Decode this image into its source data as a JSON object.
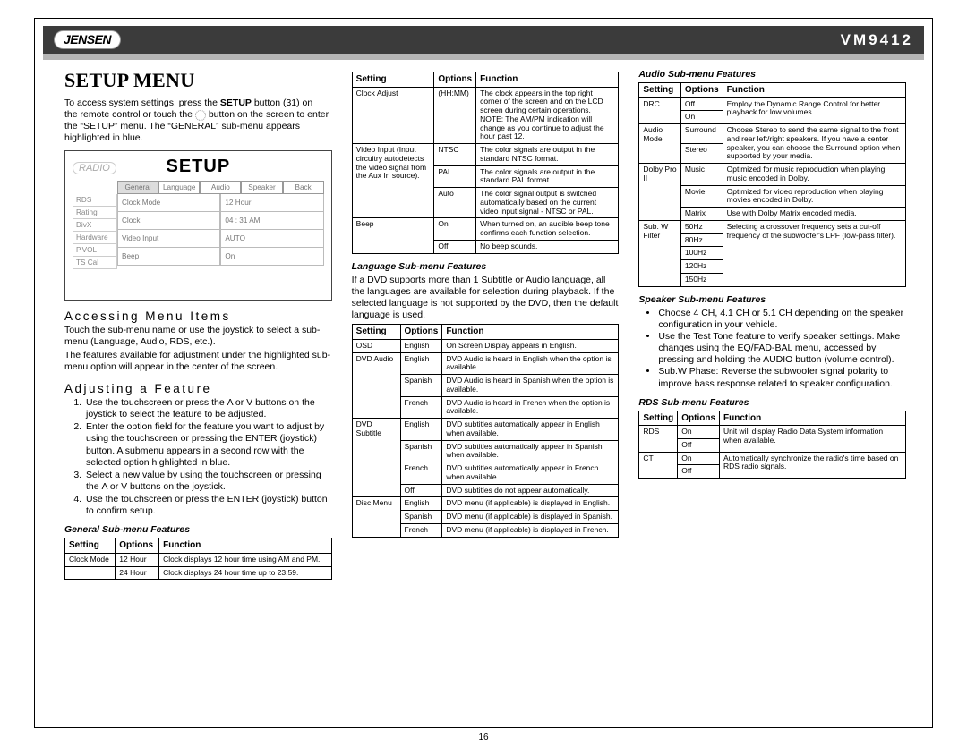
{
  "header": {
    "brand": "JENSEN",
    "model": "VM9412"
  },
  "title": "Setup Menu",
  "pagenum": "16",
  "intro": {
    "l1a": "To access system settings, press the ",
    "l1b": "SETUP",
    "l1c": " button (31) on",
    "l2a": "the remote control or touch the ",
    "l2b": " button on the screen to enter the “SETUP” menu. The “GENERAL” sub-menu appears highlighted in blue."
  },
  "setup_screen": {
    "radio": "RADIO",
    "title": "SETUP",
    "tabs": [
      "General",
      "Language",
      "Audio",
      "Speaker",
      "Back"
    ],
    "side": [
      "RDS",
      "Rating",
      "DivX",
      "Hardware",
      "P.VOL",
      "TS Cal"
    ],
    "rows": [
      [
        "Clock Mode",
        "12 Hour"
      ],
      [
        "Clock",
        "04 : 31 AM"
      ],
      [
        "Video Input",
        "AUTO"
      ],
      [
        "Beep",
        "On"
      ]
    ]
  },
  "access": {
    "h": "Accessing Menu Items",
    "p1": "Touch the sub-menu name or use the joystick to select a sub-menu (Language, Audio, RDS, etc.).",
    "p2": "The features available for adjustment under the highlighted sub-menu option will appear in the center of the screen."
  },
  "adjust": {
    "h": "Adjusting a Feature",
    "items": [
      "Use the touchscreen or press the Λ or V buttons on the joystick to select the feature to be adjusted.",
      "Enter the option field for the feature you want to adjust by using the touchscreen or pressing the ENTER (joystick) button. A submenu appears in a second row with the selected option highlighted in blue.",
      "Select a new value by using the touchscreen or pressing the Λ or V buttons on the joystick.",
      "Use the touchscreen or press the ENTER (joystick) button to confirm setup."
    ]
  },
  "th": {
    "setting": "Setting",
    "options": "Options",
    "function": "Function"
  },
  "general": {
    "h": "General Sub-menu Features",
    "rows": [
      [
        "Clock Mode",
        "12 Hour",
        "Clock displays 12 hour time using AM and PM."
      ],
      [
        "",
        "24 Hour",
        "Clock displays 24 hour time up to 23:59."
      ],
      [
        "Clock Adjust",
        "(HH:MM)",
        "The clock appears in the top right corner of the screen and on the LCD screen during certain operations. NOTE: The AM/PM indication will change as you continue to adjust the hour past 12."
      ],
      [
        "Video Input (Input circuitry autodetects the video signal from the Aux In source).",
        "NTSC",
        "The color signals are output in the standard NTSC format."
      ],
      [
        "",
        "PAL",
        "The color signals are output in the standard PAL format."
      ],
      [
        "",
        "Auto",
        "The color signal output is switched automatically based on the current video input signal - NTSC or PAL."
      ],
      [
        "Beep",
        "On",
        "When turned on, an audible beep tone confirms each function selection."
      ],
      [
        "",
        "Off",
        "No beep sounds."
      ]
    ]
  },
  "language": {
    "h": "Language Sub-menu Features",
    "p": "If a DVD supports more than 1 Subtitle or Audio language, all the languages are available for selection during playback. If the selected language is not supported by the DVD, then the default language is used.",
    "rows": [
      [
        "OSD",
        "English",
        "On Screen Display appears in English."
      ],
      [
        "DVD Audio",
        "English",
        "DVD Audio is heard in English when the option is available."
      ],
      [
        "",
        "Spanish",
        "DVD Audio is heard in Spanish when the option is available."
      ],
      [
        "",
        "French",
        "DVD Audio is heard in French when the option is available."
      ],
      [
        "DVD Subtitle",
        "English",
        "DVD subtitles automatically appear in English when available."
      ],
      [
        "",
        "Spanish",
        "DVD subtitles automatically appear in Spanish when available."
      ],
      [
        "",
        "French",
        "DVD subtitles automatically appear in French when available."
      ],
      [
        "",
        "Off",
        "DVD subtitles do not appear automatically."
      ],
      [
        "Disc Menu",
        "English",
        "DVD menu (if applicable) is displayed in English."
      ],
      [
        "",
        "Spanish",
        "DVD menu (if applicable) is displayed in Spanish."
      ],
      [
        "",
        "French",
        "DVD menu (if applicable) is displayed in French."
      ]
    ]
  },
  "audio": {
    "h": "Audio Sub-menu Features",
    "rows": [
      [
        "DRC",
        "Off",
        "Employ the Dynamic Range Control for better playback for low volumes."
      ],
      [
        "",
        "On",
        ""
      ],
      [
        "Audio Mode",
        "Surround",
        "Choose Stereo to send the same signal to the front and rear left/right speakers. If you have a center speaker, you can choose the Surround option when supported by your media."
      ],
      [
        "",
        "Stereo",
        ""
      ],
      [
        "Dolby Pro II",
        "Music",
        "Optimized for music reproduction when playing music encoded in Dolby."
      ],
      [
        "",
        "Movie",
        "Optimized for video reproduction when playing movies encoded in Dolby."
      ],
      [
        "",
        "Matrix",
        "Use with Dolby Matrix encoded media."
      ],
      [
        "Sub. W Filter",
        "50Hz",
        "Selecting a crossover frequency sets a cut-off frequency of the subwoofer's LPF (low-pass filter)."
      ],
      [
        "",
        "80Hz",
        ""
      ],
      [
        "",
        "100Hz",
        ""
      ],
      [
        "",
        "120Hz",
        ""
      ],
      [
        "",
        "150Hz",
        ""
      ]
    ]
  },
  "speaker": {
    "h": "Speaker Sub-menu Features",
    "items": [
      "Choose 4 CH, 4.1 CH or 5.1 CH depending on the speaker configuration in your vehicle.",
      "Use the Test Tone feature to verify speaker settings. Make changes using the EQ/FAD-BAL menu, accessed by pressing and holding the AUDIO button (volume control).",
      "Sub.W Phase: Reverse the subwoofer signal polarity to improve bass response related to speaker configuration."
    ]
  },
  "rds": {
    "h": "RDS Sub-menu Features",
    "rows": [
      [
        "RDS",
        "On",
        "Unit will display Radio Data System information when available."
      ],
      [
        "",
        "Off",
        ""
      ],
      [
        "CT",
        "On",
        "Automatically synchronize the radio's time based on RDS radio signals."
      ],
      [
        "",
        "Off",
        ""
      ]
    ]
  }
}
